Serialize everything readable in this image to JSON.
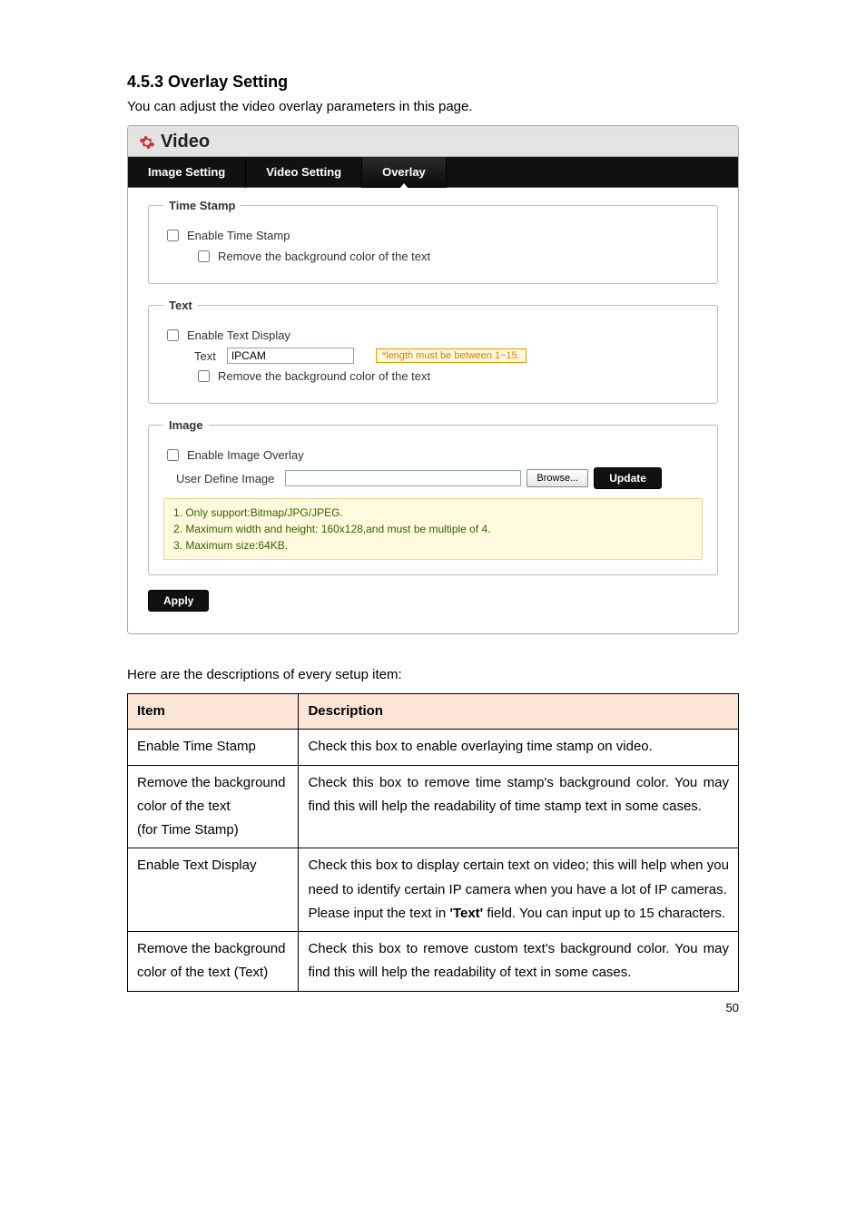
{
  "heading": "4.5.3 Overlay Setting",
  "intro": "You can adjust the video overlay parameters in this page.",
  "panel": {
    "title": "Video",
    "tabs": [
      "Image Setting",
      "Video Setting",
      "Overlay"
    ],
    "time_stamp": {
      "legend": "Time Stamp",
      "enable_label": "Enable Time Stamp",
      "remove_bg_label": "Remove the background color of the text"
    },
    "text": {
      "legend": "Text",
      "enable_label": "Enable Text Display",
      "field_label": "Text",
      "field_value": "IPCAM",
      "hint": "*length must be between 1~15.",
      "remove_bg_label": "Remove the background color of the text"
    },
    "image": {
      "legend": "Image",
      "enable_label": "Enable Image Overlay",
      "user_define_label": "User Define Image",
      "browse_label": "Browse...",
      "update_label": "Update",
      "notes": [
        "1. Only support:Bitmap/JPG/JPEG.",
        "2. Maximum width and height: 160x128,and must be multiple of 4.",
        "3. Maximum size:64KB."
      ]
    },
    "apply_label": "Apply"
  },
  "desc_intro": "Here are the descriptions of every setup item:",
  "table": {
    "headers": {
      "item": "Item",
      "desc": "Description"
    },
    "rows": [
      {
        "item": "Enable Time Stamp",
        "desc": "Check this box to enable overlaying time stamp on video."
      },
      {
        "item": "Remove the background color of the text\n(for Time Stamp)",
        "desc": "Check this box to remove time stamp's background color. You may find this will help the readability of time stamp text in some cases."
      },
      {
        "item": "Enable Text Display",
        "desc": "Check this box to display certain text on video; this will help when you need to identify certain IP camera when you have a lot of IP cameras.\nPlease input the text in 'Text' field. You can input up to 15 characters."
      },
      {
        "item": "Remove the background color of the text (Text)",
        "desc": "Check this box to remove custom text's background color. You may find this will help the readability of text in some cases."
      }
    ]
  },
  "page_number": "50"
}
